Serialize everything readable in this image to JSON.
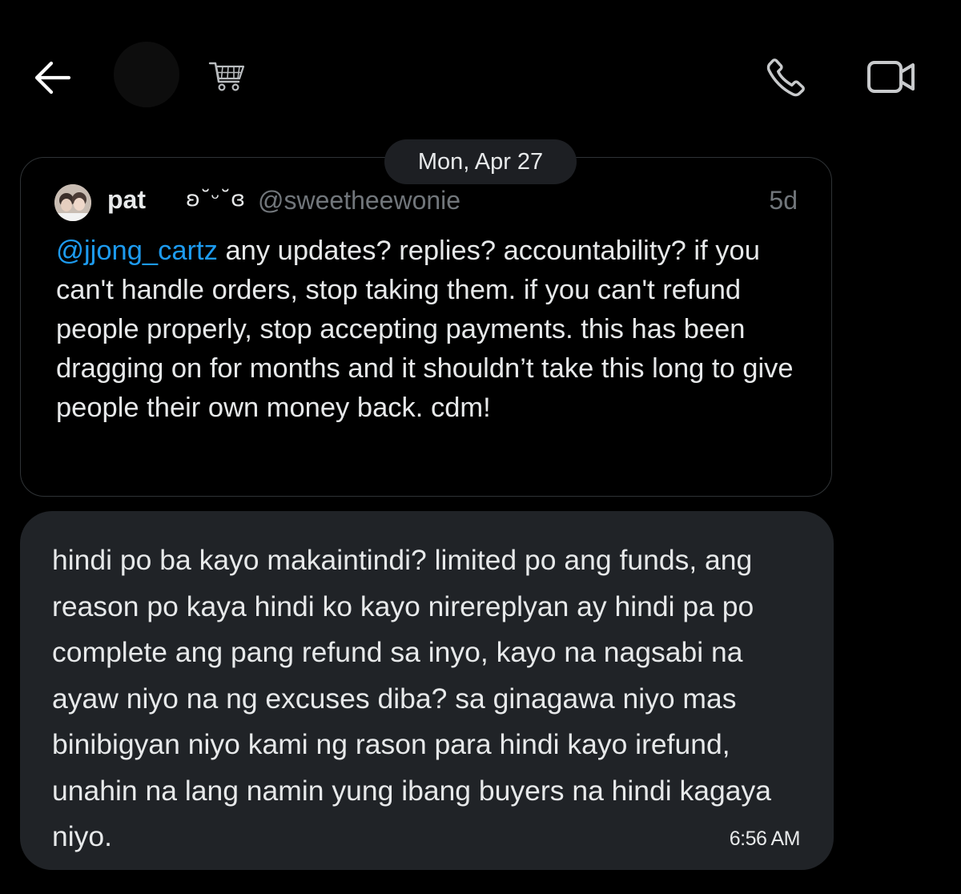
{
  "header": {
    "back_icon": "arrow-left-icon",
    "contact_emoji": "🛒",
    "call_icon": "phone-icon",
    "video_icon": "video-camera-icon"
  },
  "conversation": {
    "date_separator": "Mon, Apr 27",
    "shared_post": {
      "author_name": "pat",
      "author_emote": "ʚ˘ᵕ˘ɞ",
      "author_handle": "@sweetheewonie",
      "age": "5d",
      "mention": "@jjong_cartz",
      "text": " any updates? replies? accountability? if you can't handle orders, stop taking them. if you can't refund people properly, stop accepting payments. this has been dragging on for months and it shouldn’t take this long to give people their own money back. cdm!"
    },
    "message": {
      "text": "hindi po ba kayo makaintindi? limited po ang funds, ang reason po kaya hindi ko kayo nirereplyan ay hindi pa po complete ang pang refund sa inyo, kayo na nagsabi na ayaw niyo na ng excuses diba? sa ginagawa niyo mas binibigyan niyo kami ng rason para hindi kayo irefund, unahin na lang namin yung ibang buyers na hindi kagaya niyo.",
      "time": "6:56 AM"
    }
  },
  "colors": {
    "background": "#000000",
    "bubble": "#202327",
    "mention": "#1d9bf0",
    "secondary_text": "#71767b",
    "icon": "#c8cacc"
  }
}
